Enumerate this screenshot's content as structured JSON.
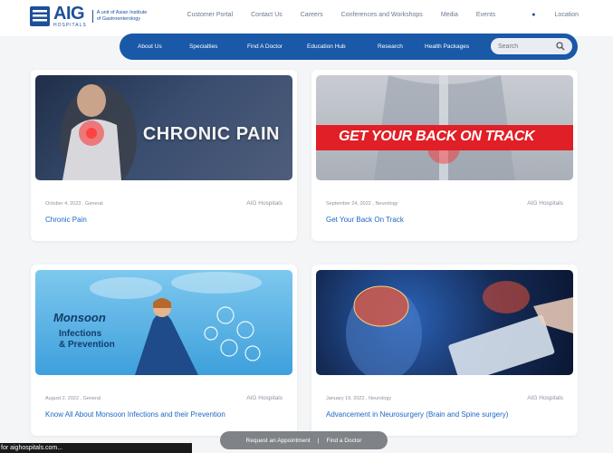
{
  "header": {
    "logo": {
      "name": "AIG",
      "sub_name": "HOSPITALS",
      "tagline": "A unit of Asian Institute of Gastroenterology"
    },
    "top_links": [
      "Customer Portal",
      "Contact Us",
      "Careers",
      "Conferences and Workshops",
      "Media",
      "Events"
    ],
    "location_label": "Location"
  },
  "nav": {
    "items": [
      "About Us",
      "Specialties",
      "Find A Doctor",
      "Education Hub",
      "Research",
      "Health Packages"
    ],
    "search_placeholder": "Search"
  },
  "cards": [
    {
      "image_text": "CHRONIC PAIN",
      "date": "October 4, 2023",
      "category": "General",
      "author": "AIG Hospitals",
      "title": "Chronic Pain"
    },
    {
      "image_text": "GET YOUR BACK ON TRACK",
      "date": "September 24, 2022",
      "category": "Neurology",
      "author": "AIG Hospitals",
      "title": "Get Your Back On Track"
    },
    {
      "image_text_line1": "Monsoon",
      "image_text_line2": "Infections",
      "image_text_line3": "& Prevention",
      "date": "August 2, 2022",
      "category": "General",
      "author": "AIG Hospitals",
      "title": "Know All About Monsoon Infections and their Prevention"
    },
    {
      "date": "January 19, 2022",
      "category": "Neurology",
      "author": "AIG Hospitals",
      "title": "Advancement in Neurosurgery (Brain and Spine surgery)"
    }
  ],
  "float_bar": {
    "request": "Request an Appointment",
    "separator": "|",
    "find": "Find a Doctor"
  },
  "status": {
    "url": "for aighospitals.com..."
  },
  "colors": {
    "brand_blue": "#1a58a8",
    "link_blue": "#1d66c4",
    "red_band": "#e11f26"
  }
}
